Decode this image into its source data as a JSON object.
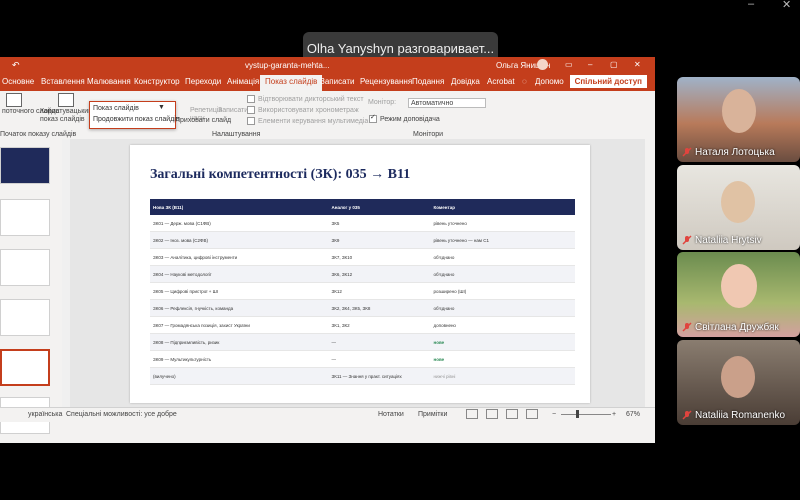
{
  "window_controls": {
    "minimize": "–",
    "close": "✕"
  },
  "banner": {
    "text": "Olha Yanyshyn разговаривает..."
  },
  "ppt": {
    "filename": "vystup-garanta-mehta...",
    "user": "Ольга Янишин",
    "tabs": [
      "Основне",
      "Вставлення",
      "Малювання",
      "Конструктор",
      "Переходи",
      "Анімація",
      "Показ слайдів",
      "Записати",
      "Рецензування",
      "Подання",
      "Довідка",
      "Acrobat"
    ],
    "help": "Допомо",
    "share": "Спільний доступ",
    "ribbon": {
      "from_current": "поточного слайда",
      "custom_show": "Користувацький показ слайдів",
      "group_start": "Початок показу слайдів",
      "rehearse": "Репетиція часу",
      "record": "Записати",
      "hide_slide": "Приховати слайд",
      "group_setup": "Налаштування",
      "play_narrations": "Відтворювати дикторський текст",
      "use_timings": "Використовувати хронометраж",
      "media_controls": "Елементи керування мультимедіа",
      "monitor_label": "Монітор:",
      "monitor_value": "Автоматично",
      "presenter_view": "Режим доповідача",
      "group_monitors": "Монітори"
    },
    "dropdown": {
      "items": [
        "Показ слайдів",
        "Продовжити показ слайдів"
      ]
    },
    "slide": {
      "title": "Загальні компетентності (ЗК): 035 → В11",
      "headers": [
        "Нова ЗК (В11)",
        "Аналог у 035",
        "Коментар"
      ],
      "rows": [
        [
          "ЗК01 — Держ. мова (C1ФВ)",
          "ЗК5",
          "рівень уточнено"
        ],
        [
          "ЗК02 — Іноз. мова (C2ФВ)",
          "ЗК9",
          "рівень уточнено — нам C1"
        ],
        [
          "ЗК03 — Аналітика, цифрові інструменти",
          "ЗК7, ЗК10",
          "об'єднано"
        ],
        [
          "ЗК04 — Наукові методології",
          "ЗК6, ЗК12",
          "об'єднано"
        ],
        [
          "ЗК05 — Цифрові пристрої + ШІ",
          "ЗК12",
          "розширено (ШІ)"
        ],
        [
          "ЗК06 — Рефлексія, гнучкість, команда",
          "ЗК2, ЗК4, ЗК5, ЗК8",
          "об'єднано"
        ],
        [
          "ЗК07 — Громадянська позиція, захист України",
          "ЗК1, ЗК2",
          "доповнено"
        ],
        [
          "ЗК08 — Підприємливість, ризик",
          "—",
          "нове"
        ],
        [
          "ЗК09 — Мультикультурність",
          "—",
          "нове"
        ],
        [
          "(вилучено)",
          "ЗК11 — Знання у практ. ситуаціях",
          "нижчі рівні"
        ]
      ]
    },
    "status": {
      "lang": "українська",
      "accessibility": "Спеціальні можливості: усе добре",
      "notes": "Нотатки",
      "comments": "Примітки",
      "zoom": "67%",
      "minus": "−",
      "plus": "+"
    }
  },
  "participants": [
    {
      "name": "Наталя Лотоцька"
    },
    {
      "name": "Nataliia Hrytsiv"
    },
    {
      "name": "Світлана Дружбяк"
    },
    {
      "name": "Nataliia Romanenko"
    }
  ],
  "colors": {
    "ppt_accent": "#c43e1c",
    "table_header": "#1f2a5a",
    "mic_off": "#e0443e"
  }
}
